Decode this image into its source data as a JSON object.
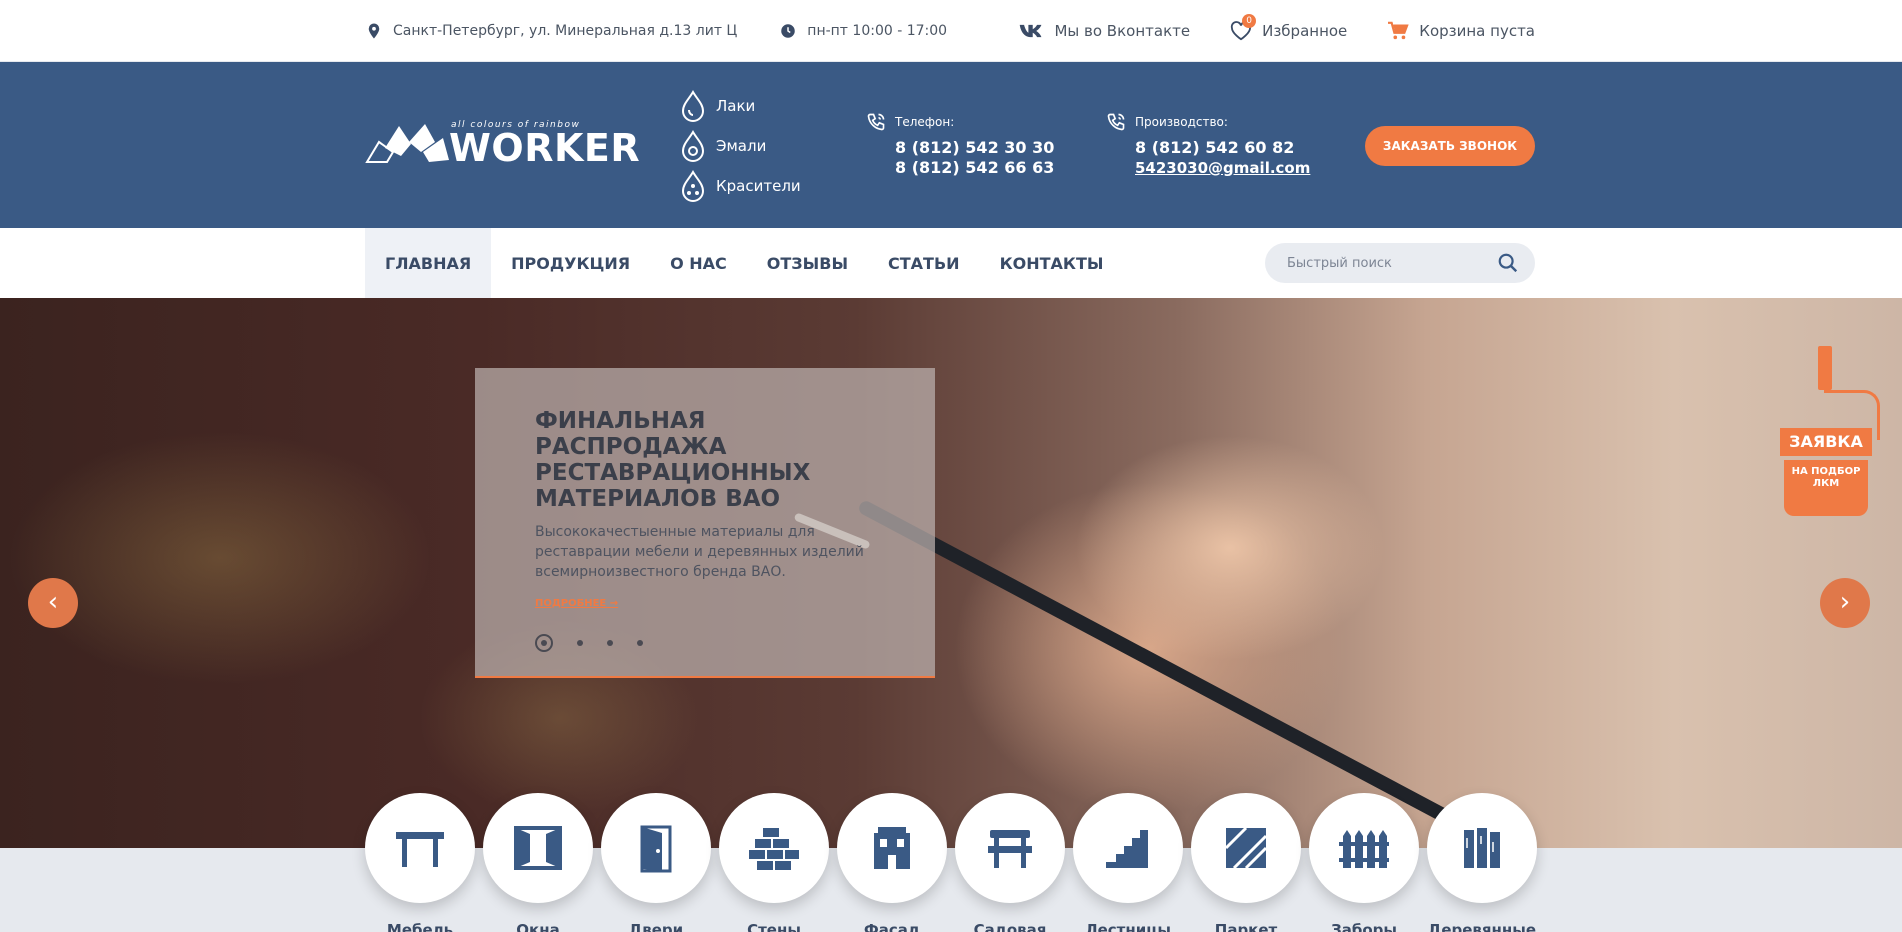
{
  "topbar": {
    "address": "Санкт-Петербург, ул. Минеральная д.13 лит Ц",
    "hours": "пн-пт 10:00 - 17:00",
    "vk": "Мы во Вконтакте",
    "favorites": "Избранное",
    "favorites_count": "0",
    "cart": "Корзина пуста"
  },
  "header": {
    "logo_tagline": "all colours of rainbow",
    "logo_name": "WORKER",
    "categories": [
      "Лаки",
      "Эмали",
      "Красители"
    ],
    "phone_label": "Телефон:",
    "phones": [
      "8 (812) 542 30 30",
      "8 (812) 542 66 63"
    ],
    "production_label": "Производство:",
    "production_phone": "8 (812) 542 60 82",
    "production_email": "5423030@gmail.com",
    "cta": "ЗАКАЗАТЬ ЗВОНОК"
  },
  "nav": {
    "items": [
      "ГЛАВНАЯ",
      "ПРОДУКЦИЯ",
      "О НАС",
      "ОТЗЫВЫ",
      "СТАТЬИ",
      "КОНТАКТЫ"
    ],
    "search_placeholder": "Быстрый поиск"
  },
  "slide": {
    "title": "ФИНАЛЬНАЯ РАСПРОДАЖА РЕСТАВРАЦИОННЫХ МАТЕРИАЛОВ ВАО",
    "text": "Высококачестыенные материалы для реставрации мебели и деревянных изделий всемирноизвестного бренда ВАО.",
    "more": "ПОДРОБНЕЕ →"
  },
  "request": {
    "title": "ЗАЯВКА",
    "subtitle": "НА ПОДБОР ЛКМ"
  },
  "circles": [
    "Мебель",
    "Окна",
    "Двери",
    "Стены",
    "Фасад",
    "Садовая",
    "Лестницы",
    "Паркет",
    "Заборы",
    "Деревянные"
  ],
  "colors": {
    "brand_blue": "#3a5a85",
    "accent": "#f07a43",
    "text_dark": "#3a4b66"
  }
}
